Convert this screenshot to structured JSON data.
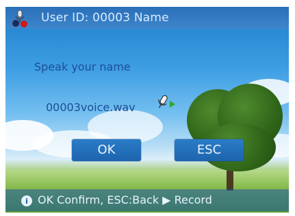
{
  "header": {
    "icon": "user-mic-icon",
    "text": "User ID: 00003  Name"
  },
  "main": {
    "prompt": "Speak your name",
    "filename": "00003voice.wav",
    "mic_icon": "microphone-icon",
    "play_icon": "play-arrow-icon"
  },
  "buttons": {
    "ok_label": "OK",
    "esc_label": "ESC"
  },
  "footer": {
    "info_icon": "info-icon",
    "text_left": "OK Confirm,  ESC:Back ",
    "arrow_icon": "play-arrow-icon",
    "text_right": " Record"
  },
  "colors": {
    "header_bg": "#3e86cc",
    "button_bg": "#2b7cc7",
    "text_dark_blue": "#1c4d95"
  }
}
